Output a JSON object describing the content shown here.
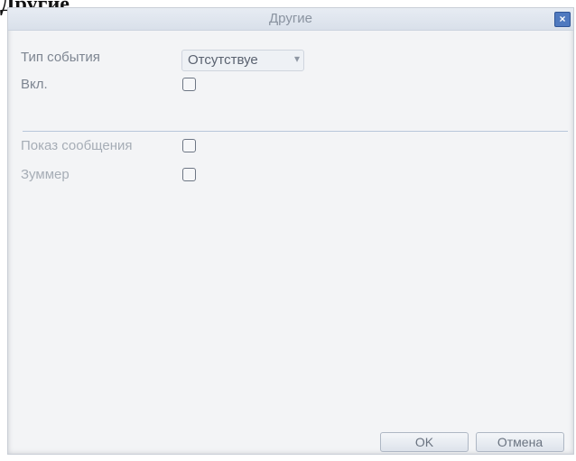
{
  "page_caption": "Другие",
  "window": {
    "title": "Другие",
    "close_icon": "close-icon"
  },
  "form": {
    "event_type": {
      "label": "Тип события",
      "value": "Отсутствуе",
      "arrow_icon": "chevron-down-icon"
    },
    "enable": {
      "label": "Вкл.",
      "checked": false
    },
    "show_message": {
      "label": "Показ сообщения",
      "checked": false
    },
    "buzzer": {
      "label": "Зуммер",
      "checked": false
    }
  },
  "buttons": {
    "ok": "OK",
    "cancel": "Отмена"
  }
}
